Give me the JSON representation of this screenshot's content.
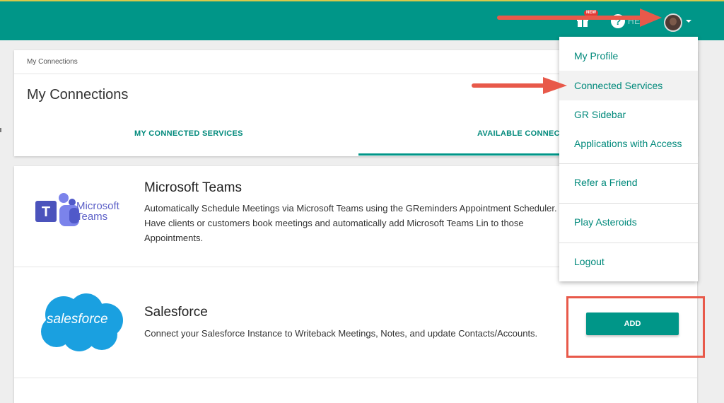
{
  "topbar": {
    "new_badge": "NEW",
    "help_label": "HELP",
    "help_glyph": "?"
  },
  "header": {
    "breadcrumb": "My Connections",
    "title": "My Connections",
    "tabs": [
      {
        "label": "MY CONNECTED SERVICES"
      },
      {
        "label": "AVAILABLE CONNECT"
      }
    ]
  },
  "services": [
    {
      "logo_text_1": "Microsoft",
      "logo_text_2": "Teams",
      "title": "Microsoft Teams",
      "description": "Automatically Schedule Meetings via Microsoft Teams using the GReminders Appointment Scheduler. Have clients or customers book meetings and automatically add Microsoft Teams Lin to those Appointments."
    },
    {
      "logo_text": "salesforce",
      "title": "Salesforce",
      "description": "Connect your Salesforce Instance to Writeback Meetings, Notes, and update Contacts/Accounts.",
      "button_label": "ADD"
    }
  ],
  "menu": {
    "items": [
      {
        "label": "My Profile"
      },
      {
        "label": "Connected Services"
      },
      {
        "label": "GR Sidebar"
      },
      {
        "label": "Applications with Access"
      },
      {
        "label": "Refer a Friend"
      },
      {
        "label": "Play Asteroids"
      },
      {
        "label": "Logout"
      }
    ]
  },
  "colors": {
    "primary": "#009688",
    "annotation": "#e8594a"
  }
}
